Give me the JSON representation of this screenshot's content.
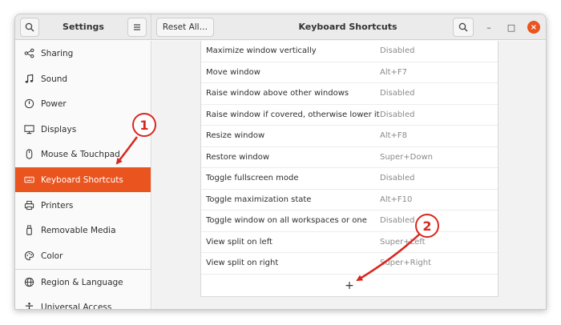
{
  "header": {
    "sidebar_title": "Settings",
    "reset_label": "Reset All…",
    "main_title": "Keyboard Shortcuts",
    "minimize": "–",
    "maximize": "□",
    "close": "×"
  },
  "sidebar": {
    "items": [
      {
        "label": "Sharing",
        "icon": "share-icon"
      },
      {
        "label": "Sound",
        "icon": "music-note-icon"
      },
      {
        "label": "Power",
        "icon": "power-icon"
      },
      {
        "label": "Displays",
        "icon": "display-icon"
      },
      {
        "label": "Mouse & Touchpad",
        "icon": "mouse-icon"
      },
      {
        "label": "Keyboard Shortcuts",
        "icon": "keyboard-icon",
        "active": true
      },
      {
        "label": "Printers",
        "icon": "printer-icon"
      },
      {
        "label": "Removable Media",
        "icon": "usb-icon"
      },
      {
        "label": "Color",
        "icon": "palette-icon"
      },
      {
        "label": "Region & Language",
        "icon": "globe-icon"
      },
      {
        "label": "Universal Access",
        "icon": "accessibility-icon"
      }
    ]
  },
  "shortcuts": [
    {
      "name": "Maximize window vertically",
      "accel": "Disabled"
    },
    {
      "name": "Move window",
      "accel": "Alt+F7"
    },
    {
      "name": "Raise window above other windows",
      "accel": "Disabled"
    },
    {
      "name": "Raise window if covered, otherwise lower it",
      "accel": "Disabled"
    },
    {
      "name": "Resize window",
      "accel": "Alt+F8"
    },
    {
      "name": "Restore window",
      "accel": "Super+Down"
    },
    {
      "name": "Toggle fullscreen mode",
      "accel": "Disabled"
    },
    {
      "name": "Toggle maximization state",
      "accel": "Alt+F10"
    },
    {
      "name": "Toggle window on all workspaces or one",
      "accel": "Disabled"
    },
    {
      "name": "View split on left",
      "accel": "Super+Left"
    },
    {
      "name": "View split on right",
      "accel": "Super+Right"
    }
  ],
  "add_button": "+",
  "annotations": {
    "badge1": "1",
    "badge2": "2",
    "color": "#d8271f"
  },
  "colors": {
    "accent": "#e9541f"
  }
}
